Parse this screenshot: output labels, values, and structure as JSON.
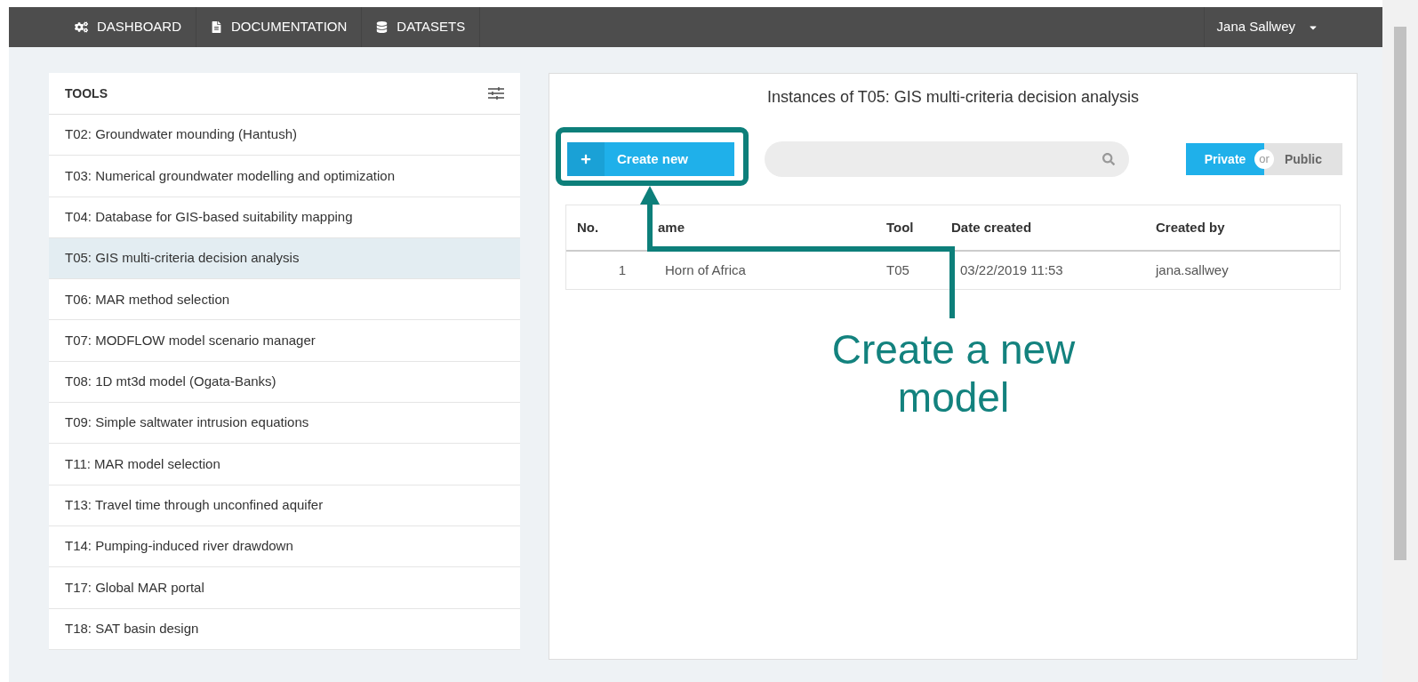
{
  "nav": {
    "items": [
      {
        "label": "DASHBOARD"
      },
      {
        "label": "DOCUMENTATION"
      },
      {
        "label": "DATASETS"
      }
    ],
    "user": "Jana Sallwey"
  },
  "sidebar": {
    "title": "TOOLS",
    "items": [
      {
        "label": "T02: Groundwater mounding (Hantush)",
        "selected": false
      },
      {
        "label": "T03: Numerical groundwater modelling and optimization",
        "selected": false
      },
      {
        "label": "T04: Database for GIS-based suitability mapping",
        "selected": false
      },
      {
        "label": "T05: GIS multi-criteria decision analysis",
        "selected": true
      },
      {
        "label": "T06: MAR method selection",
        "selected": false
      },
      {
        "label": "T07: MODFLOW model scenario manager",
        "selected": false
      },
      {
        "label": "T08: 1D mt3d model (Ogata-Banks)",
        "selected": false
      },
      {
        "label": "T09: Simple saltwater intrusion equations",
        "selected": false
      },
      {
        "label": "T11: MAR model selection",
        "selected": false
      },
      {
        "label": "T13: Travel time through unconfined aquifer",
        "selected": false
      },
      {
        "label": "T14: Pumping-induced river drawdown",
        "selected": false
      },
      {
        "label": "T17: Global MAR portal",
        "selected": false
      },
      {
        "label": "T18: SAT basin design",
        "selected": false
      }
    ]
  },
  "main": {
    "title": "Instances of T05: GIS multi-criteria decision analysis",
    "create_button": "Create new",
    "toggle": [
      {
        "label": "Private",
        "selected": true
      },
      {
        "label": "Public",
        "selected": false
      }
    ],
    "toggle_separator": "or",
    "table": {
      "columns": [
        "No.",
        "ame",
        "Tool",
        "Date created",
        "Created by"
      ],
      "rows": [
        [
          "1",
          "Horn of Africa",
          "T05",
          "03/22/2019 11:53",
          "jana.sallwey"
        ]
      ]
    }
  },
  "annotation": {
    "text": "Create a new model"
  }
}
